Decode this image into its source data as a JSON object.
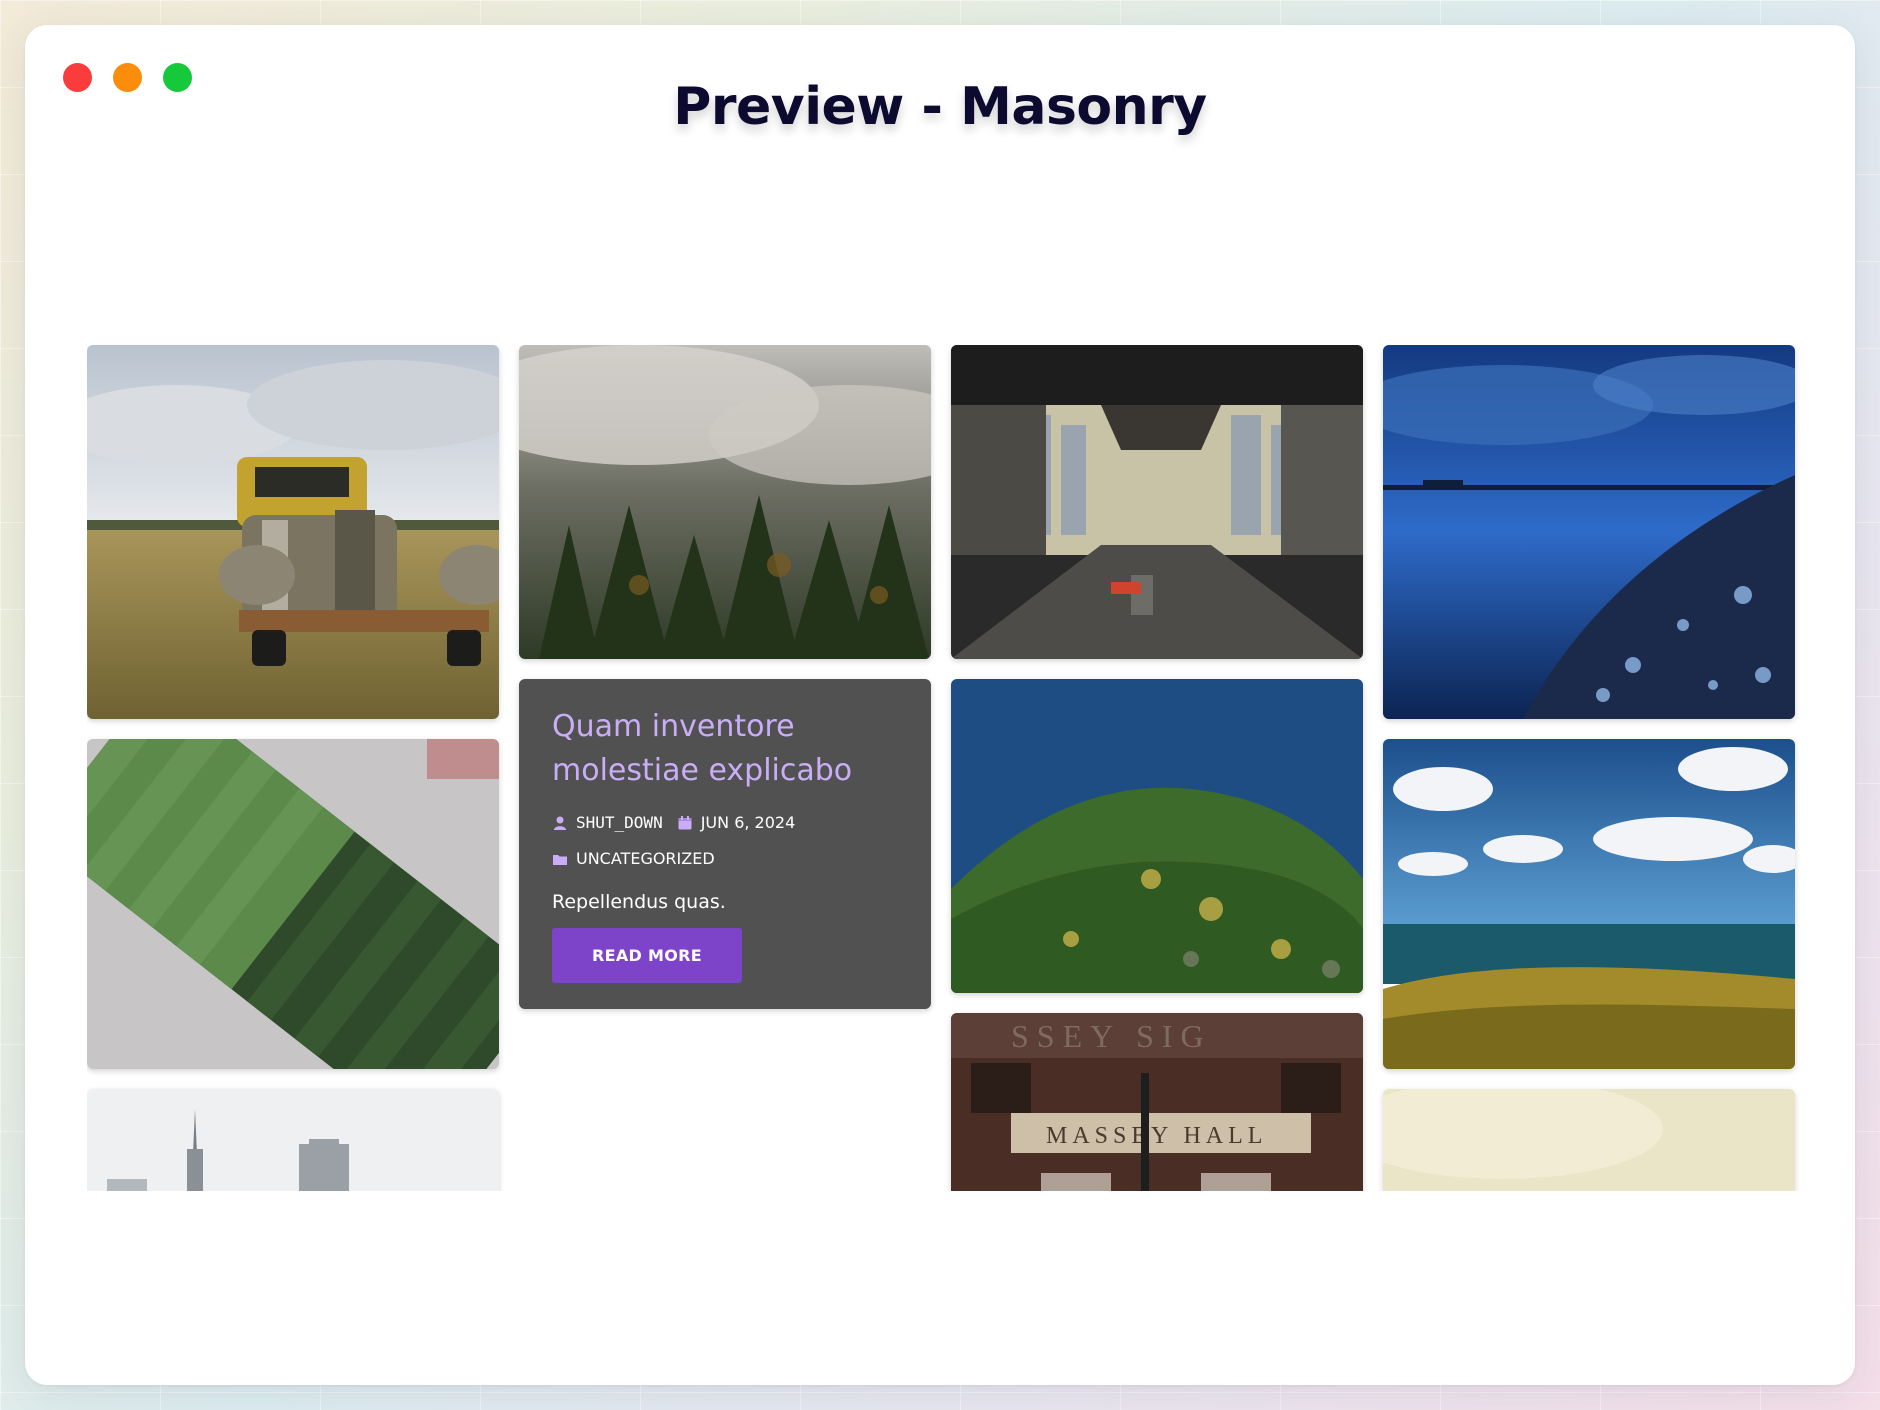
{
  "window": {
    "title": "Preview - Masonry",
    "controls": [
      "close",
      "minimize",
      "maximize"
    ]
  },
  "masonry": {
    "columns": 4,
    "image_cards": [
      {
        "name": "old-rusty-truck-in-field"
      },
      {
        "name": "foggy-pine-forest"
      },
      {
        "name": "city-street-through-pallet"
      },
      {
        "name": "blue-icy-shoreline"
      },
      {
        "name": "aerial-soccer-stadium"
      },
      {
        "name": "aerial-forest-island"
      },
      {
        "name": "coastal-meadow-with-clouds"
      },
      {
        "name": "city-skyline-towers"
      },
      {
        "name": "massey-hall-facade"
      },
      {
        "name": "pale-yellow-sky"
      }
    ],
    "post": {
      "title": "Quam inventore molestiae explicabo",
      "author": "SHUT_DOWN",
      "date": "JUN 6, 2024",
      "category": "UNCATEGORIZED",
      "excerpt": "Repellendus quas.",
      "button_label": "READ MORE",
      "title_color": "#c9aef7",
      "button_color": "#7d43c8"
    }
  }
}
